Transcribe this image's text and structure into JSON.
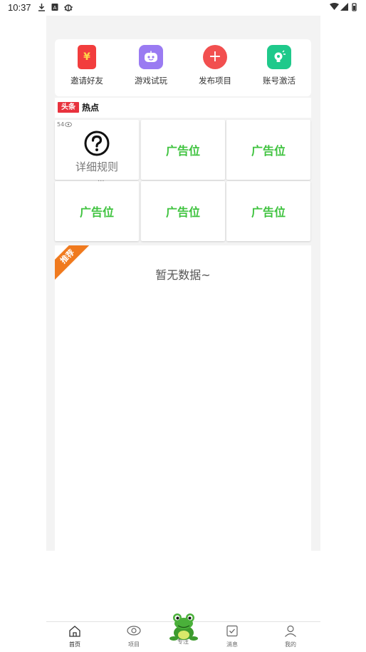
{
  "status_bar": {
    "time": "10:37"
  },
  "quick_menu": [
    {
      "label": "邀请好友",
      "icon": "red-envelope-icon",
      "color": "#f23d3d",
      "glyph": "¥"
    },
    {
      "label": "游戏试玩",
      "icon": "game-robot-icon",
      "color": "#9a7bf2",
      "glyph": ""
    },
    {
      "label": "发布项目",
      "icon": "plus-circle-icon",
      "color": "#f24f4f",
      "glyph": "+"
    },
    {
      "label": "账号激活",
      "icon": "lightbulb-icon",
      "color": "#1fc98b",
      "glyph": ""
    }
  ],
  "hot": {
    "logo": "头条",
    "title": "热点"
  },
  "grid": {
    "view_count": "54",
    "rule_label": "详细规则",
    "ad_label": "广告位",
    "dots": "..."
  },
  "recommend": {
    "ribbon": "推荐",
    "empty": "暂无数据~"
  },
  "tabbar": [
    {
      "label": "首页",
      "icon": "home-icon",
      "active": true
    },
    {
      "label": "项目",
      "icon": "eye-icon",
      "active": false
    },
    {
      "label": "专注",
      "icon": "frog-icon",
      "active": false
    },
    {
      "label": "消息",
      "icon": "checkbox-icon",
      "active": false
    },
    {
      "label": "我的",
      "icon": "user-icon",
      "active": false
    }
  ],
  "colors": {
    "ad_green": "#3fc33f",
    "ribbon_orange": "#f07a1e",
    "toutiao_red": "#e8323d"
  }
}
